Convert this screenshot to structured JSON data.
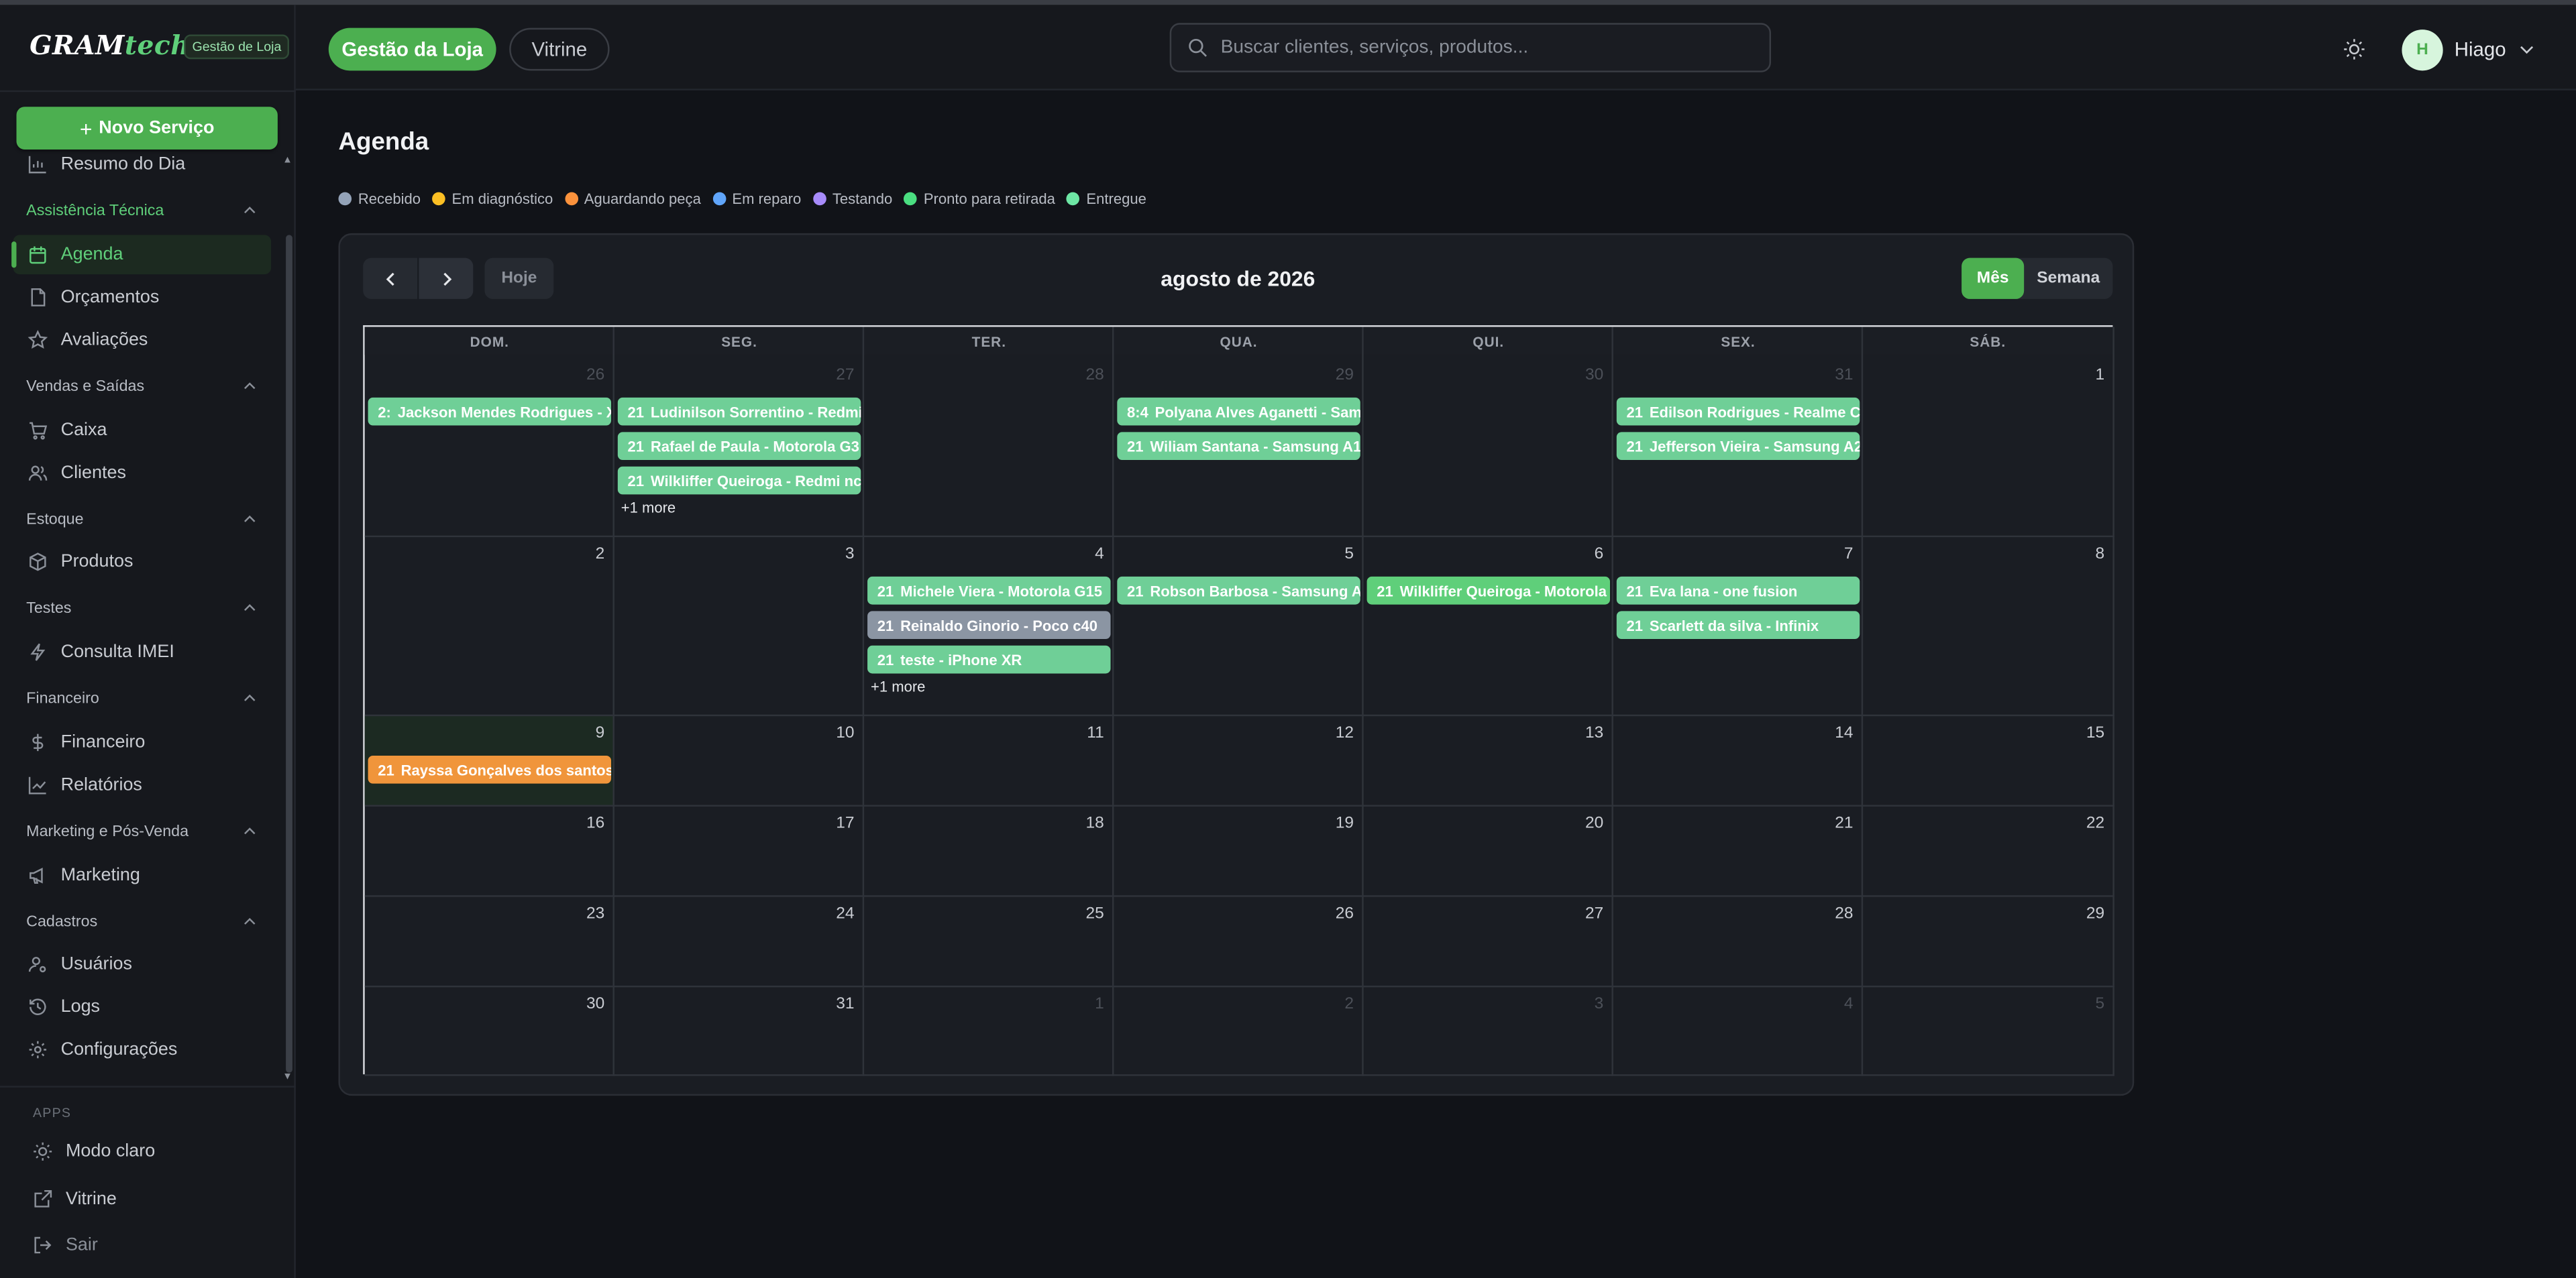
{
  "brand": {
    "logo_gram": "GRAM",
    "logo_tech": "tech",
    "badge": "Gestão de Loja"
  },
  "sidebar": {
    "new_service": "Novo Serviço",
    "resumo": "Resumo do Dia",
    "groups": {
      "assistencia": "Assistência Técnica",
      "vendas": "Vendas e Saídas",
      "estoque": "Estoque",
      "testes": "Testes",
      "financeiro": "Financeiro",
      "marketing": "Marketing e Pós-Venda",
      "cadastros": "Cadastros"
    },
    "items": {
      "agenda": "Agenda",
      "orcamentos": "Orçamentos",
      "avaliacoes": "Avaliações",
      "caixa": "Caixa",
      "clientes": "Clientes",
      "produtos": "Produtos",
      "consulta_imei": "Consulta IMEI",
      "financeiro": "Financeiro",
      "relatorios": "Relatórios",
      "marketing": "Marketing",
      "usuarios": "Usuários",
      "logs": "Logs",
      "configuracoes": "Configurações"
    },
    "apps_title": "APPS",
    "apps": {
      "modo_claro": "Modo claro",
      "vitrine": "Vitrine",
      "sair": "Sair"
    }
  },
  "topbar": {
    "tab_store": "Gestão da Loja",
    "tab_vitrine": "Vitrine",
    "search_placeholder": "Buscar clientes, serviços, produtos...",
    "avatar_initial": "H",
    "user_name": "Hiago"
  },
  "page": {
    "title": "Agenda"
  },
  "legend": [
    {
      "label": "Recebido",
      "color": "#94a3b8"
    },
    {
      "label": "Em diagnóstico",
      "color": "#fbbf24"
    },
    {
      "label": "Aguardando peça",
      "color": "#fb923c"
    },
    {
      "label": "Em reparo",
      "color": "#60a5fa"
    },
    {
      "label": "Testando",
      "color": "#a78bfa"
    },
    {
      "label": "Pronto para retirada",
      "color": "#4ade80"
    },
    {
      "label": "Entregue",
      "color": "#6ee7a5"
    }
  ],
  "calendar": {
    "today_label": "Hoje",
    "title": "agosto de 2026",
    "view_month": "Mês",
    "view_week": "Semana",
    "dow": [
      "DOM.",
      "SEG.",
      "TER.",
      "QUA.",
      "QUI.",
      "SEX.",
      "SÁB."
    ],
    "weeks": [
      [
        "26",
        "27",
        "28",
        "29",
        "30",
        "31",
        "1"
      ],
      [
        "2",
        "3",
        "4",
        "5",
        "6",
        "7",
        "8"
      ],
      [
        "9",
        "10",
        "11",
        "12",
        "13",
        "14",
        "15"
      ],
      [
        "16",
        "17",
        "18",
        "19",
        "20",
        "21",
        "22"
      ],
      [
        "23",
        "24",
        "25",
        "26",
        "27",
        "28",
        "29"
      ],
      [
        "30",
        "31",
        "1",
        "2",
        "3",
        "4",
        "5"
      ]
    ],
    "events": {
      "e1": {
        "time": "2:",
        "text": "Jackson Mendes Rodrigues - X"
      },
      "e2": {
        "time": "21",
        "text": "Ludinilson Sorrentino - Redmi"
      },
      "e3": {
        "time": "21",
        "text": "Rafael de Paula - Motorola G3"
      },
      "e4": {
        "time": "21",
        "text": "Wilkliffer Queiroga - Redmi nc"
      },
      "e5": {
        "time": "8:4",
        "text": "Polyana Alves Aganetti - Sam"
      },
      "e6": {
        "time": "21",
        "text": "Wiliam Santana - Samsung A1"
      },
      "e7": {
        "time": "21",
        "text": "Edilson Rodrigues - Realme C"
      },
      "e8": {
        "time": "21",
        "text": "Jefferson Vieira - Samsung A2"
      },
      "e9": {
        "time": "21",
        "text": "Michele Viera - Motorola G15"
      },
      "e10": {
        "time": "21",
        "text": "Reinaldo Ginorio - Poco c40"
      },
      "e11": {
        "time": "21",
        "text": "teste - iPhone XR"
      },
      "e12": {
        "time": "21",
        "text": "Robson Barbosa - Samsung A"
      },
      "e13": {
        "time": "21",
        "text": "Wilkliffer Queiroga - Motorola"
      },
      "e14": {
        "time": "21",
        "text": "Eva lana - one fusion"
      },
      "e15": {
        "time": "21",
        "text": "Scarlett da silva - Infinix"
      },
      "e16": {
        "time": "21",
        "text": "Rayssa Gonçalves dos santos -"
      }
    },
    "more1": "+1 more",
    "more2": "+1 more"
  }
}
